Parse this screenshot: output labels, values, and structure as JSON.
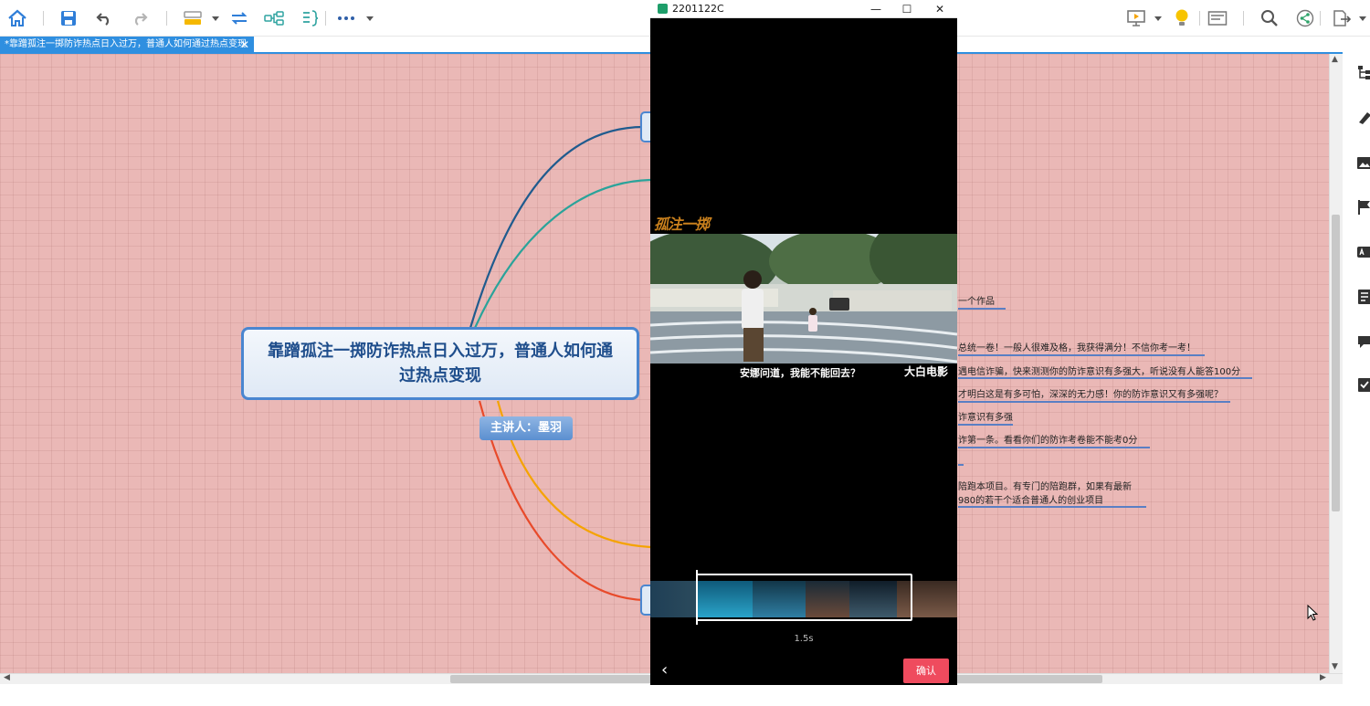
{
  "tab": {
    "title": "*靠蹭孤注一掷防诈热点日入过万，普通人如何通过热点变现",
    "close": "✕"
  },
  "mindmap": {
    "root": "靠蹭孤注一掷防诈热点日入过万，普通人如何通过热点变现",
    "speaker": "主讲人：墨羽",
    "branches": [
      "一个作品",
      "总统一卷！一般人很难及格，我获得满分！不信你考一考！",
      "遇电信诈骗，快来测测你的防诈意识有多强大，听说没有人能答100分",
      "才明白这是有多可怕，深深的无力感！你的防诈意识又有多强呢？",
      "诈意识有多强",
      "诈第一条。看看你们的防诈考卷能不能考0分",
      "陪跑本项目。有专门的陪跑群，如果有最新",
      "980的若干个适合普通人的创业项目"
    ],
    "colors": {
      "canvas": "#eab8b6",
      "root_border": "#4a86d0",
      "branch_line": "#5a7fc4"
    }
  },
  "video_window": {
    "title": "2201122C",
    "minimize": "—",
    "maximize": "☐",
    "close": "✕",
    "logo": "孤注一掷",
    "subtitle": "安娜问道，我能不能回去？",
    "watermark": "大白电影",
    "duration": "1.5s",
    "back": "‹",
    "confirm": "确认",
    "confirm_color": "#ef4b5e"
  },
  "scroll": {
    "up": "▲",
    "down": "▼",
    "left": "◀",
    "right": "▶"
  },
  "toolbar_icons": [
    "home-icon",
    "save-icon",
    "undo-icon",
    "redo-icon",
    "style-icon",
    "connect-icon",
    "relation-icon",
    "summary-icon",
    "more-icon",
    "present-icon",
    "idea-icon",
    "outline-icon",
    "search-icon",
    "share-icon",
    "export-icon"
  ]
}
